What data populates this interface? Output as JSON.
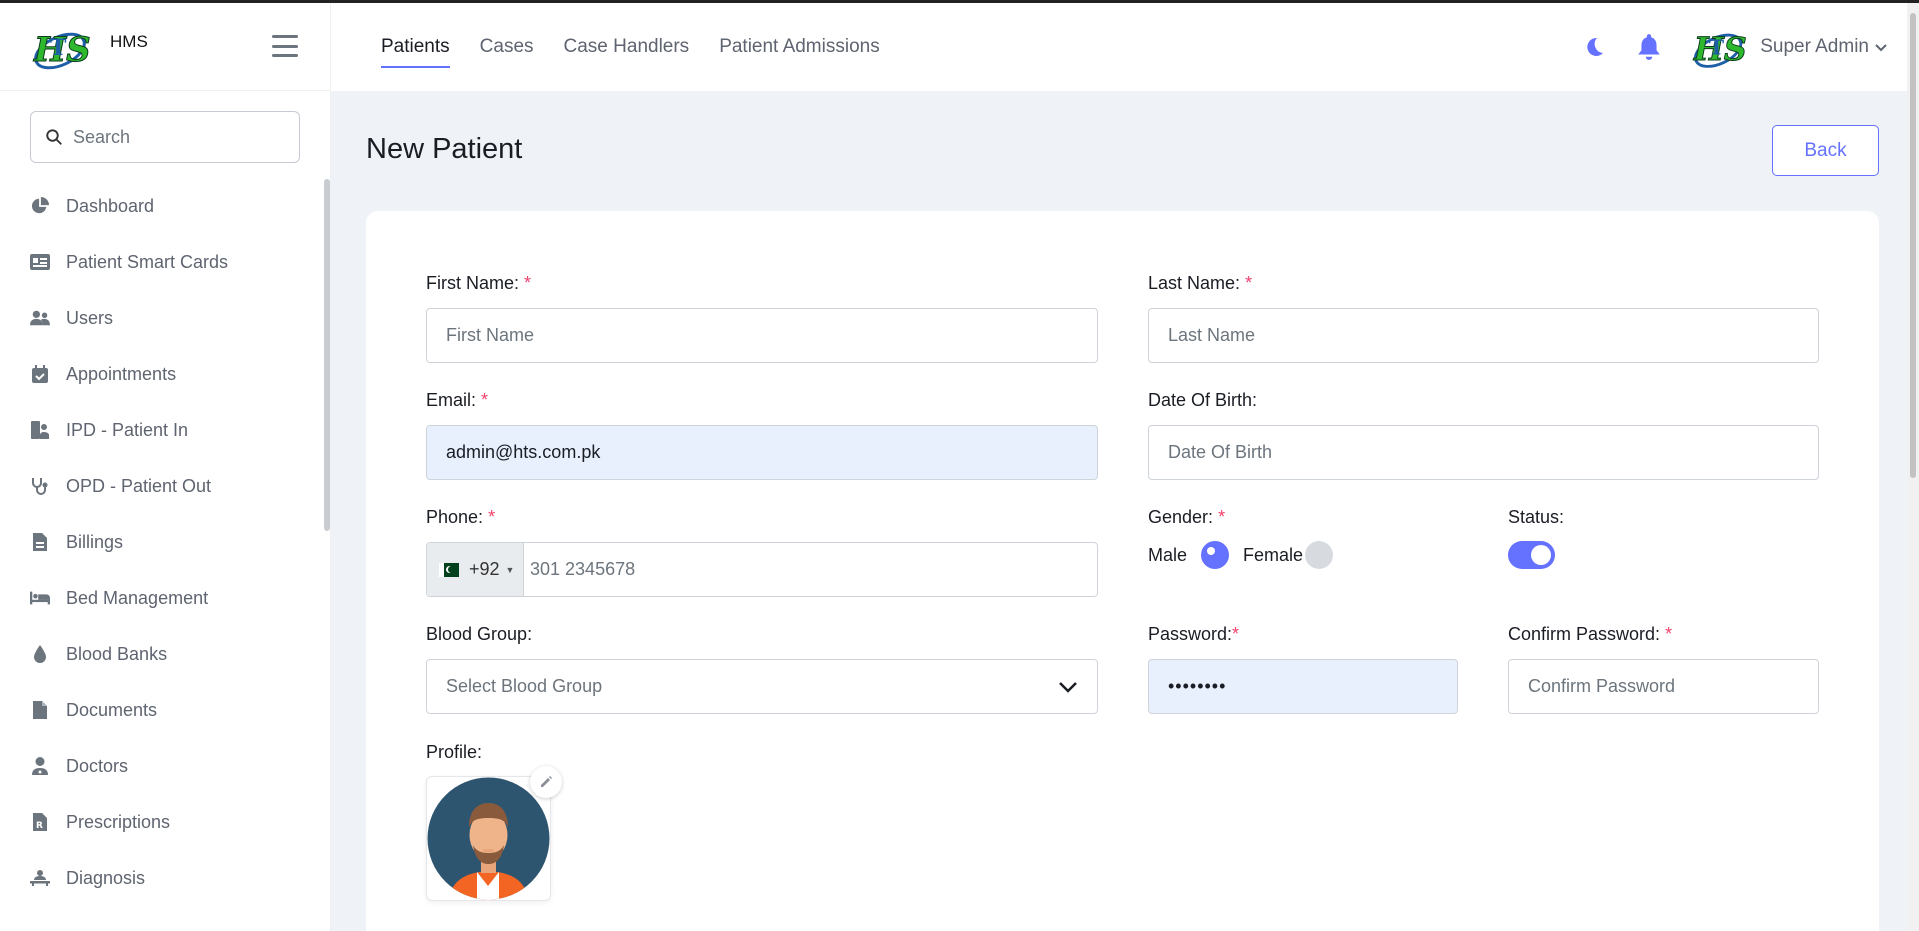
{
  "app": {
    "brand": "HMS",
    "logo_text": "HTS"
  },
  "sidebar": {
    "search_placeholder": "Search",
    "items": [
      {
        "label": "Dashboard",
        "icon": "pie-chart-icon"
      },
      {
        "label": "Patient Smart Cards",
        "icon": "id-card-icon"
      },
      {
        "label": "Users",
        "icon": "users-icon"
      },
      {
        "label": "Appointments",
        "icon": "calendar-check-icon"
      },
      {
        "label": "IPD - Patient In",
        "icon": "bed-patient-icon"
      },
      {
        "label": "OPD - Patient Out",
        "icon": "stethoscope-icon"
      },
      {
        "label": "Billings",
        "icon": "invoice-icon"
      },
      {
        "label": "Bed Management",
        "icon": "bed-icon"
      },
      {
        "label": "Blood Banks",
        "icon": "droplet-icon"
      },
      {
        "label": "Documents",
        "icon": "file-icon"
      },
      {
        "label": "Doctors",
        "icon": "doctor-icon"
      },
      {
        "label": "Prescriptions",
        "icon": "prescription-icon"
      },
      {
        "label": "Diagnosis",
        "icon": "diagnosis-icon"
      }
    ]
  },
  "header": {
    "tabs": [
      {
        "label": "Patients",
        "active": true
      },
      {
        "label": "Cases",
        "active": false
      },
      {
        "label": "Case Handlers",
        "active": false
      },
      {
        "label": "Patient Admissions",
        "active": false
      }
    ],
    "user_name": "Super Admin"
  },
  "page": {
    "title": "New Patient",
    "back_label": "Back"
  },
  "form": {
    "first_name": {
      "label": "First Name:",
      "required": "*",
      "placeholder": "First Name"
    },
    "last_name": {
      "label": "Last Name:",
      "required": "*",
      "placeholder": "Last Name"
    },
    "email": {
      "label": "Email:",
      "required": "*",
      "value": "admin@hts.com.pk"
    },
    "dob": {
      "label": "Date Of Birth:",
      "placeholder": "Date Of Birth"
    },
    "phone": {
      "label": "Phone:",
      "required": "*",
      "country_code": "+92",
      "placeholder": "301 2345678"
    },
    "gender": {
      "label": "Gender:",
      "required": "*",
      "male": "Male",
      "female": "Female",
      "selected": "Male"
    },
    "status": {
      "label": "Status:",
      "enabled": true
    },
    "blood_group": {
      "label": "Blood Group:",
      "placeholder": "Select Blood Group"
    },
    "password": {
      "label": "Password:",
      "required": "*",
      "value": "••••••••"
    },
    "confirm_password": {
      "label": "Confirm Password:",
      "required": "*",
      "placeholder": "Confirm Password"
    },
    "profile": {
      "label": "Profile:"
    }
  },
  "colors": {
    "accent": "#6571ff",
    "required": "#f1416c",
    "logo_green": "#2eb82e",
    "logo_blue": "#1e5fa8"
  }
}
